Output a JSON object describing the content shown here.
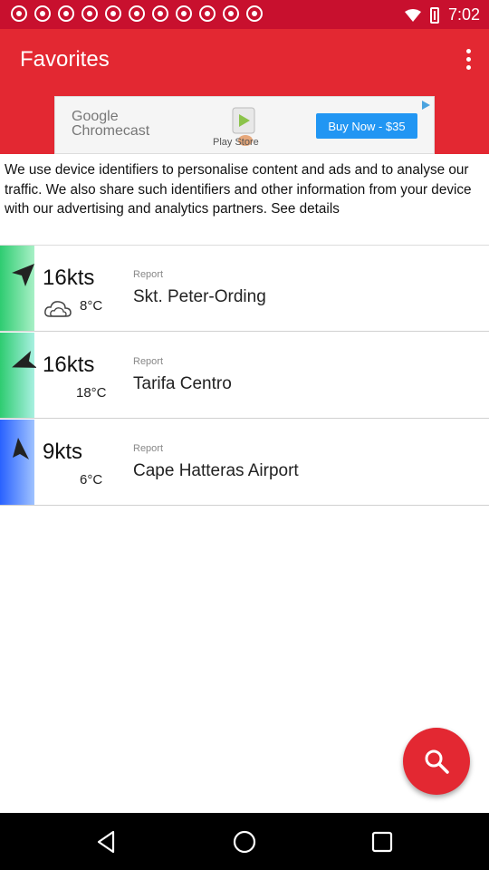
{
  "status_bar": {
    "time": "7:02",
    "notification_icons": [
      "soccer-ball-icon",
      "soccer-ball-icon",
      "soccer-ball-icon",
      "soccer-ball-icon",
      "soccer-ball-icon",
      "soccer-ball-icon",
      "soccer-ball-icon",
      "soccer-ball-icon",
      "soccer-ball-icon",
      "soccer-ball-icon",
      "soccer-ball-icon"
    ]
  },
  "app_bar": {
    "title": "Favorites",
    "menu_icon": "more-vert-icon"
  },
  "ad": {
    "brand": "Google\nChromecast",
    "play_label": "Play Store",
    "button_label": "Buy Now - $35"
  },
  "consent_text": "We use device identifiers to personalise content and ads and to analyse our traffic. We also share such identifiers and other information from your device with our advertising and analytics partners. See details",
  "favorites": [
    {
      "speed": "16kts",
      "temperature": "8°C",
      "weather_icon": "cloud-icon",
      "report_label": "Report",
      "place": "Skt. Peter-Ording",
      "strip_color": "#2ecc71"
    },
    {
      "speed": "16kts",
      "temperature": "18°C",
      "weather_icon": "",
      "report_label": "Report",
      "place": "Tarifa Centro",
      "strip_color": "#2ecc71"
    },
    {
      "speed": "9kts",
      "temperature": "6°C",
      "weather_icon": "",
      "report_label": "Report",
      "place": "Cape Hatteras Airport",
      "strip_color": "#2979ff"
    }
  ],
  "fab": {
    "icon": "search-icon"
  },
  "nav_bar": {
    "buttons": [
      "back-icon",
      "home-icon",
      "recents-icon"
    ]
  },
  "colors": {
    "primary": "#e32832",
    "status_bar": "#c8102e",
    "ad_button": "#2196f3"
  }
}
